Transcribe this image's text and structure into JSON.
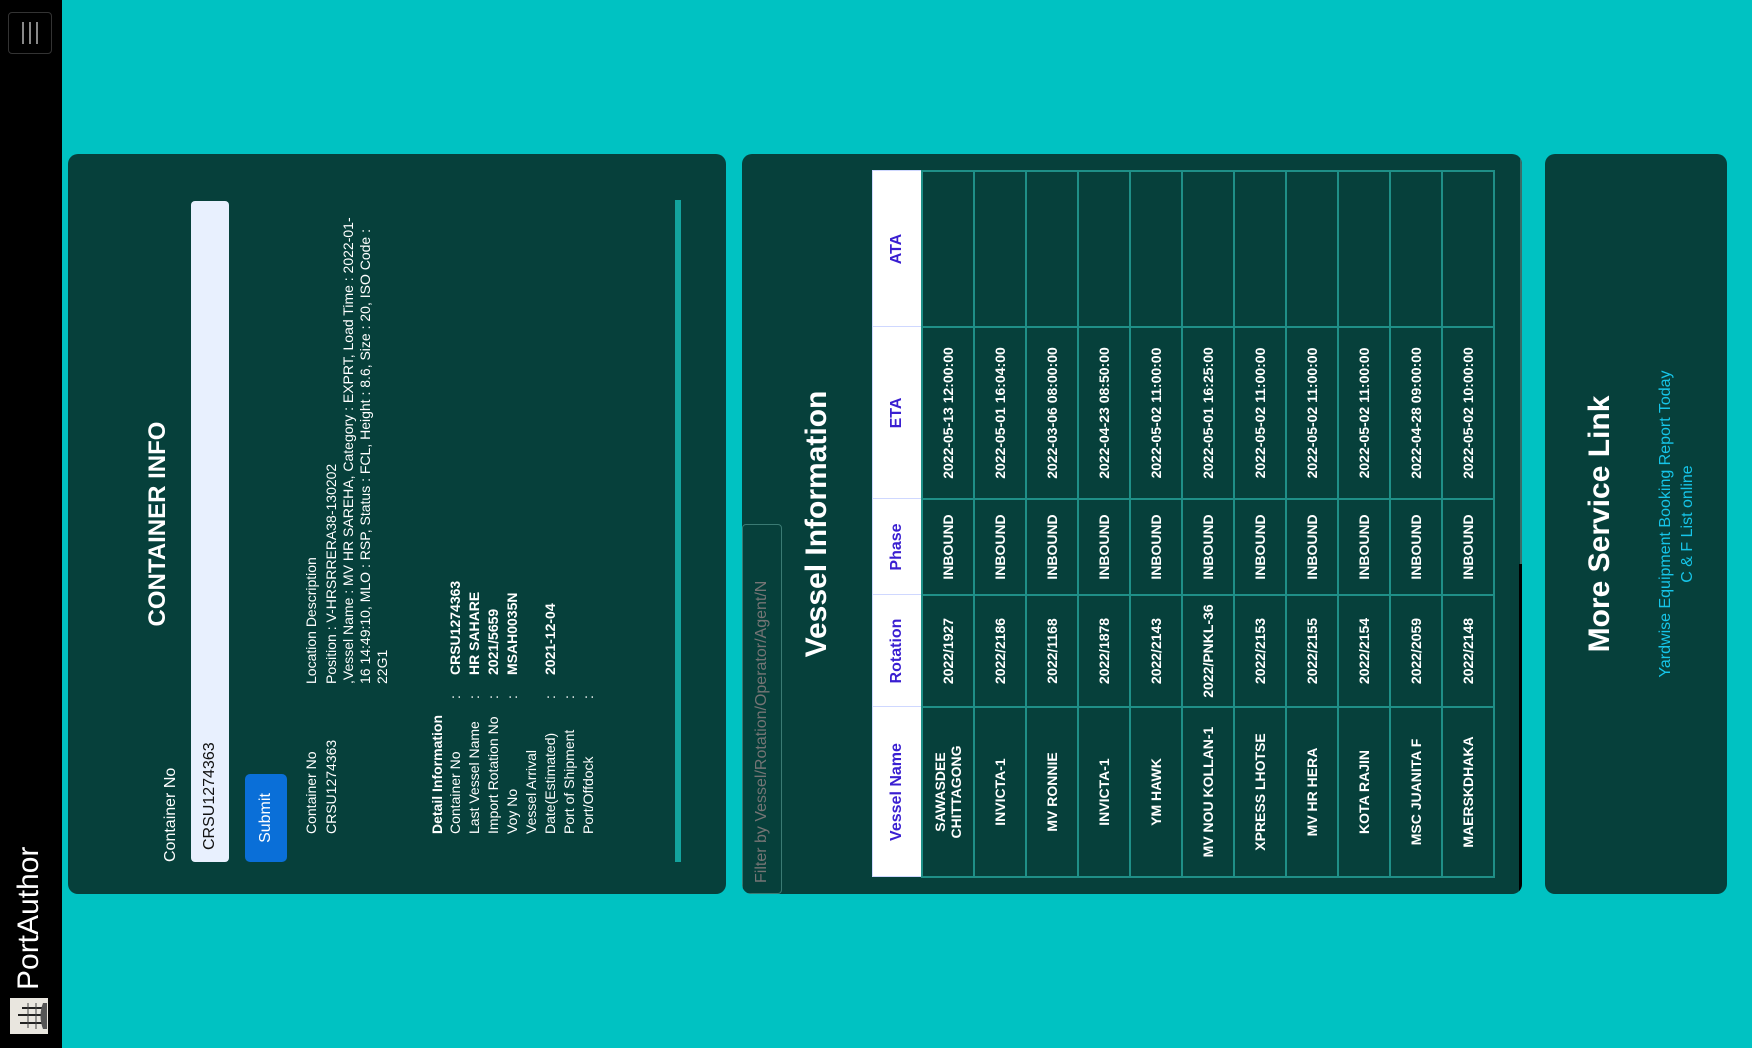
{
  "navbar": {
    "brand": "PortAuthor"
  },
  "container_info": {
    "title": "CONTAINER INFO",
    "input_label": "Container No",
    "input_value": "CRSU1274363",
    "submit_label": "Submit",
    "location_header": {
      "left": "Container No",
      "right": "Location Description"
    },
    "location_container_no": "CRSU1274363",
    "location_lines": [
      "Position : V-HRSRRERA38-130202",
      ",Vessel Name : MV HR SAREHA, Category : EXPRT, Load Time : 2022-01-16 14:49:10, MLO : RSP, Status : FCL, Height : 8.6, Size : 20, ISO Code : 22G1"
    ],
    "detail_title": "Detail Information",
    "details": [
      {
        "label": "Container No",
        "value": "CRSU1274363"
      },
      {
        "label": "Last Vessel Name",
        "value": "HR SAHARE"
      },
      {
        "label": "Import Rotation No",
        "value": "2021/5659"
      },
      {
        "label": "Voy No",
        "value": "MSAH0035N"
      },
      {
        "label": "Vessel Arrival",
        "value": ""
      },
      {
        "label": "Date(Estimated)",
        "value": "2021-12-04"
      },
      {
        "label": "Port of Shipment",
        "value": ""
      },
      {
        "label": "Port/Offdock",
        "value": ""
      }
    ],
    "colon": ":"
  },
  "vessel_info": {
    "filter_placeholder": "Filter by Vessel/Rotation/Operator/Agent/N",
    "title": "Vessel Information",
    "columns": [
      "Vessel Name",
      "Rotation",
      "Phase",
      "ETA",
      "ATA"
    ],
    "rows": [
      [
        "SAWASDEE CHITTAGONG",
        "2022/1927",
        "INBOUND",
        "2022-05-13 12:00:00",
        ""
      ],
      [
        "INVICTA-1",
        "2022/2186",
        "INBOUND",
        "2022-05-01 16:04:00",
        ""
      ],
      [
        "MV RONNIE",
        "2022/1168",
        "INBOUND",
        "2022-03-06 08:00:00",
        ""
      ],
      [
        "INVICTA-1",
        "2022/1878",
        "INBOUND",
        "2022-04-23 08:50:00",
        ""
      ],
      [
        "YM HAWK",
        "2022/2143",
        "INBOUND",
        "2022-05-02 11:00:00",
        ""
      ],
      [
        "MV NOU KOLLAN-1",
        "2022/PNKL-36",
        "INBOUND",
        "2022-05-01 16:25:00",
        ""
      ],
      [
        "XPRESS LHOTSE",
        "2022/2153",
        "INBOUND",
        "2022-05-02 11:00:00",
        ""
      ],
      [
        "MV HR HERA",
        "2022/2155",
        "INBOUND",
        "2022-05-02 11:00:00",
        ""
      ],
      [
        "KOTA RAJIN",
        "2022/2154",
        "INBOUND",
        "2022-05-02 11:00:00",
        ""
      ],
      [
        "MSC JUANITA F",
        "2022/2059",
        "INBOUND",
        "2022-04-28 09:00:00",
        ""
      ],
      [
        "MAERSKDHAKA",
        "2022/2148",
        "INBOUND",
        "2022-05-02 10:00:00",
        ""
      ]
    ]
  },
  "service_links": {
    "title": "More Service Link",
    "links": [
      "Yardwise Equipment Booking Report Today",
      "C & F List online"
    ]
  }
}
